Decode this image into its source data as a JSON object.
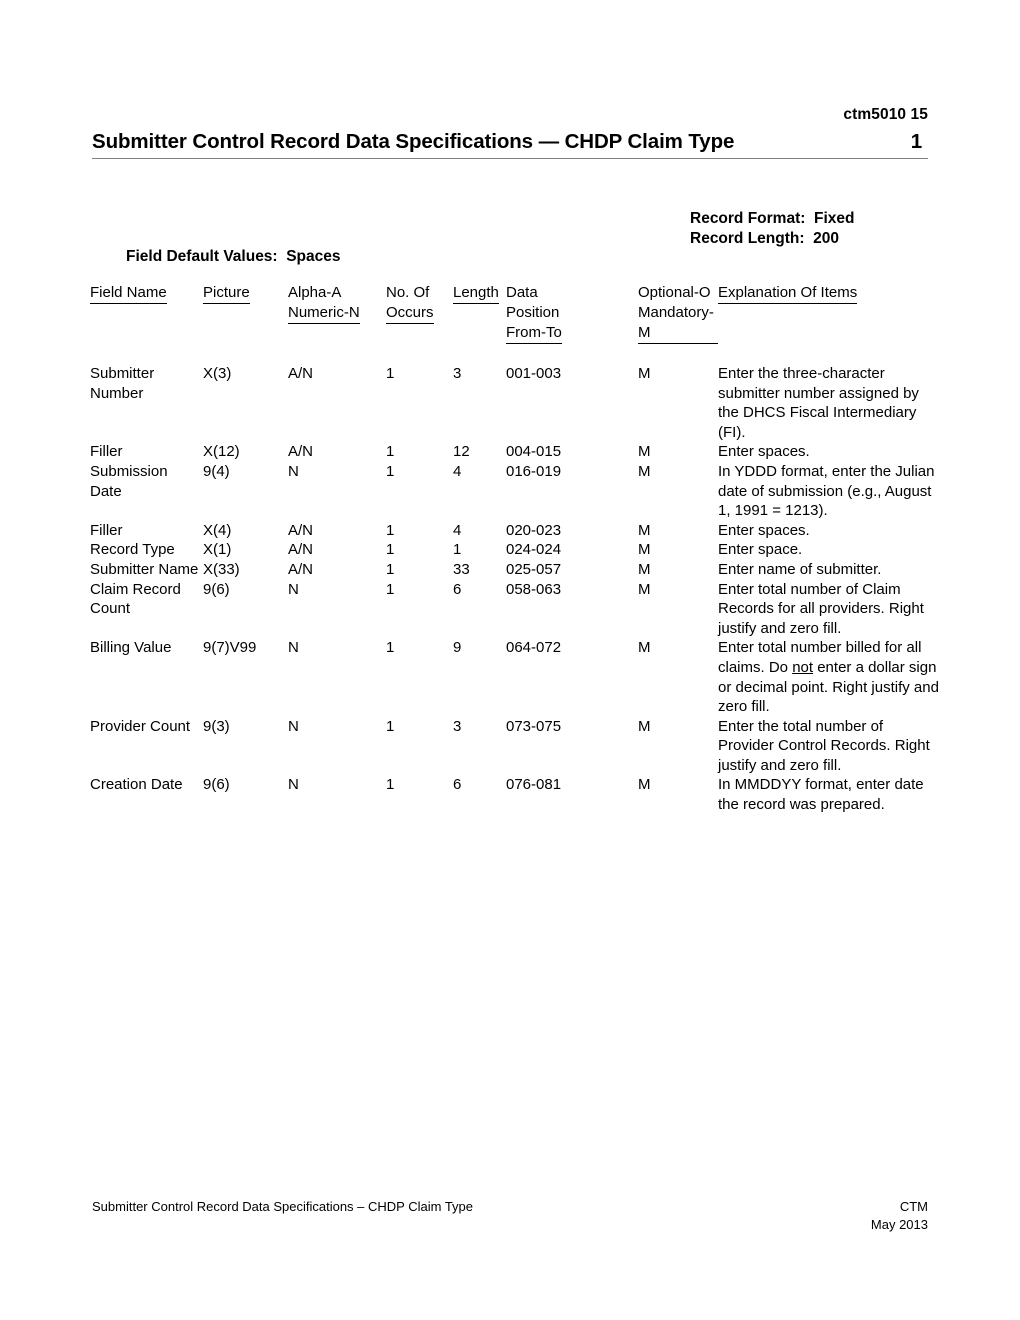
{
  "header": {
    "doc_code": "ctm5010 15",
    "title": "Submitter Control Record Data Specifications — CHDP Claim Type",
    "page_number": "1"
  },
  "meta": {
    "record_format": "Record Format:  Fixed",
    "record_length": "Record Length:  200",
    "field_default_values": "Field Default Values:  Spaces"
  },
  "table": {
    "headers": {
      "field_name": "Field Name",
      "picture": "Picture",
      "alpha_numeric_line1": "Alpha-A",
      "alpha_numeric_line2": "Numeric-N",
      "occurs_line1": "No. Of",
      "occurs_line2": "Occurs",
      "length": "Length",
      "position_line1": "Data",
      "position_line2": "Position",
      "position_line3": "From-To",
      "optional_line1": "Optional-O",
      "optional_line2": "Mandatory-M",
      "explanation": "Explanation Of Items"
    },
    "rows": [
      {
        "field_name": "Submitter Number",
        "picture": "X(3)",
        "alpha_numeric": "A/N",
        "occurs": "1",
        "length": "3",
        "position": "001-003",
        "optional_mandatory": "M",
        "explanation": "Enter the three-character submitter number assigned by the DHCS Fiscal Intermediary (FI)."
      },
      {
        "field_name": "Filler",
        "picture": "X(12)",
        "alpha_numeric": "A/N",
        "occurs": "1",
        "length": "12",
        "position": "004-015",
        "optional_mandatory": "M",
        "explanation": "Enter spaces."
      },
      {
        "field_name": "Submission Date",
        "picture": "9(4)",
        "alpha_numeric": "N",
        "occurs": "1",
        "length": "4",
        "position": "016-019",
        "optional_mandatory": "M",
        "explanation": "In YDDD format, enter the Julian date of submission (e.g., August 1, 1991 = 1213)."
      },
      {
        "field_name": "Filler",
        "picture": "X(4)",
        "alpha_numeric": "A/N",
        "occurs": "1",
        "length": "4",
        "position": "020-023",
        "optional_mandatory": "M",
        "explanation": "Enter spaces."
      },
      {
        "field_name": "Record Type",
        "picture": "X(1)",
        "alpha_numeric": "A/N",
        "occurs": "1",
        "length": "1",
        "position": "024-024",
        "optional_mandatory": "M",
        "explanation": "Enter space."
      },
      {
        "field_name": "Submitter Name",
        "picture": "X(33)",
        "alpha_numeric": "A/N",
        "occurs": "1",
        "length": "33",
        "position": "025-057",
        "optional_mandatory": "M",
        "explanation": "Enter name of submitter."
      },
      {
        "field_name": "Claim Record Count",
        "picture": "9(6)",
        "alpha_numeric": "N",
        "occurs": "1",
        "length": "6",
        "position": "058-063",
        "optional_mandatory": "M",
        "explanation": "Enter total number of Claim Records for all providers. Right justify and zero fill."
      },
      {
        "field_name": "Billing Value",
        "picture": "9(7)V99",
        "alpha_numeric": "N",
        "occurs": "1",
        "length": "9",
        "position": "064-072",
        "optional_mandatory": "M",
        "explanation_part1": "Enter total number billed for all claims.  Do ",
        "explanation_underlined": "not",
        "explanation_part2": " enter a dollar sign or decimal point. Right justify and zero fill."
      },
      {
        "field_name": "Provider Count",
        "picture": "9(3)",
        "alpha_numeric": "N",
        "occurs": "1",
        "length": "3",
        "position": "073-075",
        "optional_mandatory": "M",
        "explanation": "Enter the total number of Provider Control Records. Right justify and zero fill."
      },
      {
        "field_name": "Creation Date",
        "picture": "9(6)",
        "alpha_numeric": "N",
        "occurs": "1",
        "length": "6",
        "position": "076-081",
        "optional_mandatory": "M",
        "explanation": "In MMDDYY format, enter date the record was prepared."
      }
    ]
  },
  "footer": {
    "left": "Submitter Control Record Data Specifications – CHDP Claim Type",
    "right_line1": "CTM",
    "right_line2": "May 2013"
  }
}
